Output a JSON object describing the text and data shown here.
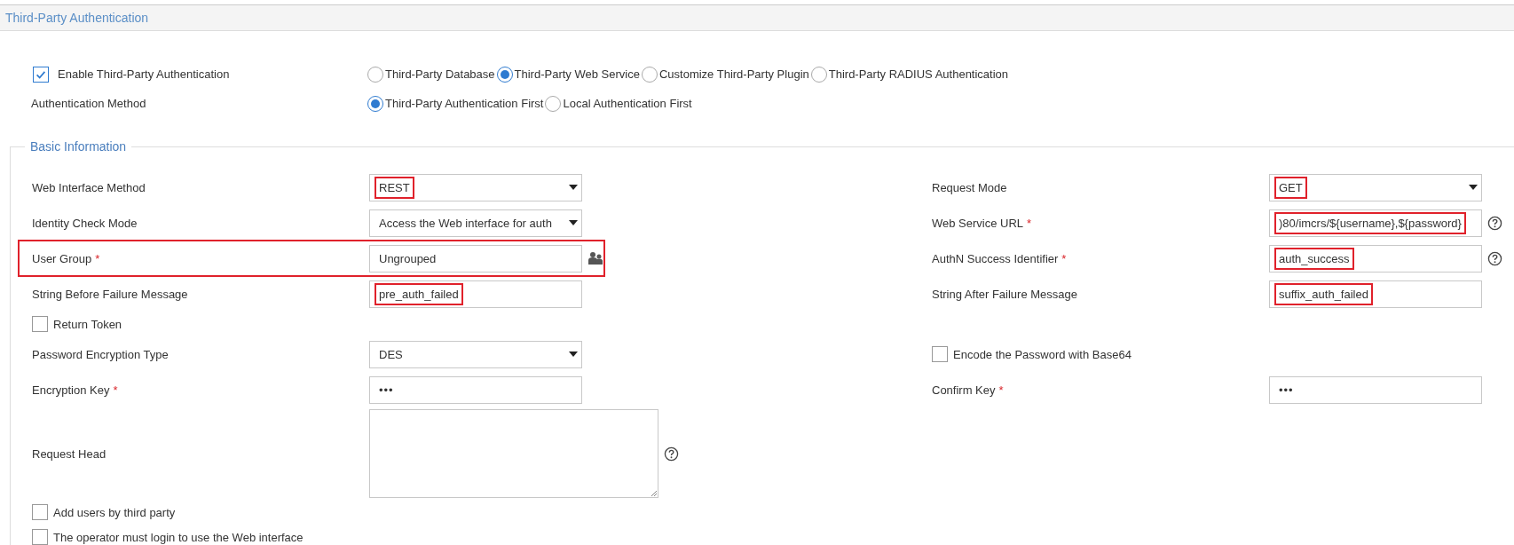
{
  "page_title": "Third-Party Authentication",
  "enable": {
    "label": "Enable Third-Party Authentication",
    "checked": true
  },
  "auth_types": [
    {
      "label": "Third-Party Database",
      "selected": false
    },
    {
      "label": "Third-Party Web Service",
      "selected": true
    },
    {
      "label": "Customize Third-Party Plugin",
      "selected": false
    },
    {
      "label": "Third-Party RADIUS Authentication",
      "selected": false
    }
  ],
  "auth_method": {
    "label": "Authentication Method",
    "options": [
      {
        "label": "Third-Party Authentication First",
        "selected": true
      },
      {
        "label": "Local Authentication First",
        "selected": false
      }
    ]
  },
  "basic_info": {
    "legend": "Basic Information",
    "rows": [
      {
        "left": {
          "kind": "select",
          "label": "Web Interface Method",
          "value": "REST",
          "highlighted": true
        },
        "right": {
          "kind": "select",
          "label": "Request Mode",
          "value": "GET",
          "highlighted": true
        }
      },
      {
        "left": {
          "kind": "select",
          "label": "Identity Check Mode",
          "value": "Access the Web interface for auth"
        },
        "right": {
          "kind": "text",
          "label": "Web Service URL",
          "required_mark": "*",
          "value": ")80/imcrs/${username},${password}",
          "highlighted": true,
          "help": true
        }
      },
      {
        "highlighted": true,
        "left": {
          "kind": "text",
          "label": "User Group",
          "required_mark": "*",
          "value": "Ungrouped",
          "group_picker": true
        },
        "right": {
          "kind": "text",
          "label": "AuthN Success Identifier",
          "required_mark": "*",
          "value": "auth_success",
          "highlighted": true,
          "help": true
        }
      },
      {
        "left": {
          "kind": "text",
          "label": "String Before Failure Message",
          "value": "pre_auth_failed",
          "highlighted": true
        },
        "right": {
          "kind": "text",
          "label": "String After Failure Message",
          "value": "suffix_auth_failed",
          "highlighted": true
        }
      },
      {
        "left": {
          "kind": "checkbox",
          "label": "Return Token",
          "checked": false
        }
      },
      {
        "left": {
          "kind": "select",
          "label": "Password Encryption Type",
          "value": "DES"
        },
        "right": {
          "kind": "checkbox",
          "label": "Encode the Password with Base64",
          "checked": false
        }
      },
      {
        "left": {
          "kind": "password",
          "label": "Encryption Key",
          "required_mark": "*",
          "value": "•••"
        },
        "right": {
          "kind": "password",
          "label": "Confirm Key",
          "required_mark": "*",
          "value": "•••"
        }
      },
      {
        "left": {
          "kind": "textarea",
          "label": "Request Head",
          "help": true
        }
      },
      {
        "left": {
          "kind": "checkbox",
          "label": "Add users by third party",
          "checked": false
        }
      },
      {
        "left": {
          "kind": "checkbox",
          "label": "The operator must login to use the Web interface",
          "checked": false
        }
      }
    ]
  }
}
